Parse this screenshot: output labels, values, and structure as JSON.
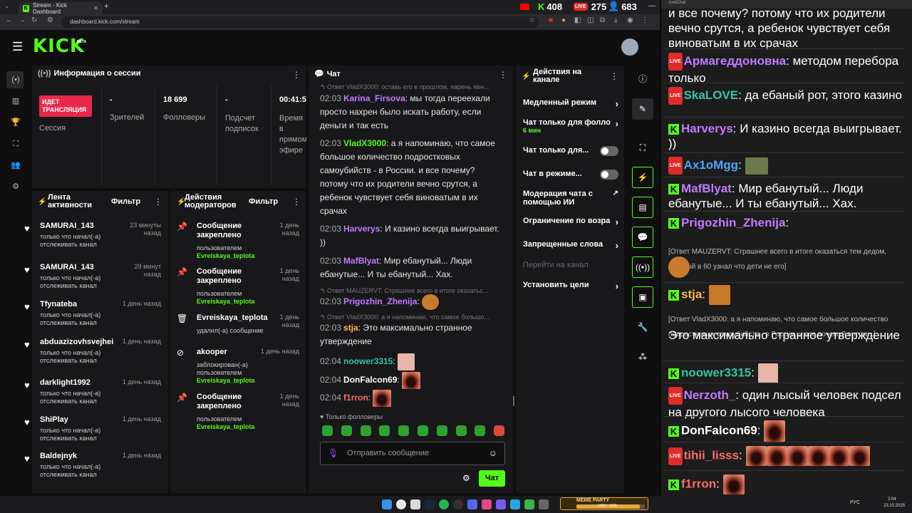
{
  "browser": {
    "tab_title": "Stream - Kick Dashboard",
    "url": "dashboard.kick.com/stream",
    "new_tab": "+",
    "viewers": [
      {
        "platform": "youtube",
        "count": "408"
      },
      {
        "platform": "kick-live",
        "count": "275"
      },
      {
        "platform": "people",
        "count": "683"
      }
    ],
    "window_controls": [
      "—",
      "▢",
      "✕"
    ]
  },
  "header": {
    "logo": "KICK",
    "logo_badge": "BETA"
  },
  "session": {
    "title": "Информация о сессии",
    "live_label_1": "ИДЕТ",
    "live_label_2": "ТРАНСЛЯЦИЯ",
    "session_label": "Сессия",
    "viewers_value": "-",
    "viewers_label": "Зрителей",
    "followers_value": "18 699",
    "followers_label": "Фолловеры",
    "subs_value": "-",
    "subs_label_1": "Подсчет",
    "subs_label_2": "подписок",
    "time_value": "00:41:5",
    "time_label_1": "Время в",
    "time_label_2": "прямом",
    "time_label_3": "эфире"
  },
  "activity": {
    "title_1": "Лента",
    "title_2": "активности",
    "filter": "Фильтр",
    "items": [
      {
        "name": "SAMURAI_143",
        "time": "23 минуты назад",
        "sub_1": "только что начал(-а)",
        "sub_2": "отслеживать канал"
      },
      {
        "name": "SAMURAI_143",
        "time": "29 минут назад",
        "sub_1": "только что начал(-а)",
        "sub_2": "отслеживать канал"
      },
      {
        "name": "Tfynateba",
        "time": "1 день назад",
        "sub_1": "только что начал(-а)",
        "sub_2": "отслеживать канал"
      },
      {
        "name": "abduazizovhsvejhei",
        "time": "1 день назад",
        "sub_1": "только что начал(-а)",
        "sub_2": "отслеживать канал"
      },
      {
        "name": "darklight1992",
        "time": "1 день назад",
        "sub_1": "только что начал(-а)",
        "sub_2": "отслеживать канал"
      },
      {
        "name": "ShiPlay",
        "time": "1 день назад",
        "sub_1": "только что начал(-а)",
        "sub_2": "отслеживать канал"
      },
      {
        "name": "Baldejnyk",
        "time": "1 день назад",
        "sub_1": "только что начал(-а)",
        "sub_2": "отслеживать канал"
      }
    ]
  },
  "mod": {
    "title_1": "Действия",
    "title_2": "модераторов",
    "filter": "Фильтр",
    "items": [
      {
        "line_1": "Сообщение",
        "line_2": "закреплено",
        "sub": "пользователем",
        "user": "Evreiskaya_teplota",
        "time_1": "1 день",
        "time_2": "назад"
      },
      {
        "line_1": "Сообщение",
        "line_2": "закреплено",
        "sub": "пользователем",
        "user": "Evreiskaya_teplota",
        "time_1": "1 день",
        "time_2": "назад"
      },
      {
        "line_1": "Evreiskaya_teplota",
        "line_2": "",
        "sub": "удалил(-а) сообщение",
        "user": "",
        "time_1": "1 день",
        "time_2": "назад"
      },
      {
        "line_1": "akooper",
        "line_2": "",
        "sub": "заблокирован(-а)",
        "sub_2": "пользователем",
        "user": "Evreiskaya_teplota",
        "time_1": "1 день назад",
        "time_2": ""
      },
      {
        "line_1": "Сообщение",
        "line_2": "закреплено",
        "sub": "пользователем",
        "user": "Evreiskaya_teplota",
        "time_1": "1 день",
        "time_2": "назад"
      }
    ]
  },
  "chat": {
    "title": "Чат",
    "top_reply": "↰ Ответ VladX3000: оставь его в прошлом, парень явн...",
    "messages": [
      {
        "time": "02:03",
        "user": "Karina_Firsova",
        "color": "#c07cff",
        "text": "мы тогда переехали просто нахрен было искать работу, если деньги и так есть"
      },
      {
        "time": "02:03",
        "user": "VladX3000",
        "color": "#53fc18",
        "text": "а я напоминаю, что самое большое количество подростковых самоубийств - в России. и все почему? потому что их родители вечно срутся, а ребенок чувствует себя виноватым в их срачах"
      },
      {
        "time": "02:03",
        "user": "Harverys",
        "color": "#c07cff",
        "text": "И казино всегда выигрывает. ))"
      },
      {
        "time": "02:03",
        "user": "MafBlyat",
        "color": "#c07cff",
        "text": "Мир ебанутый... Люди ебанутые... И ты ебанутый... Хах."
      },
      {
        "time": "02:03",
        "user": "Prigozhin_Zhenija",
        "color": "#c07cff",
        "text": ""
      },
      {
        "time": "02:03",
        "user": "stja",
        "color": "#ffb84d",
        "text": "Это максимально странное утверждение"
      },
      {
        "time": "02:04",
        "user": "noower3315",
        "color": "#39c2a8",
        "text": ""
      },
      {
        "time": "02:04",
        "user": "DonFalcon69",
        "color": "#ffffff",
        "text": ""
      },
      {
        "time": "02:04",
        "user": "f1rron",
        "color": "#ff6b6b",
        "text": ""
      }
    ],
    "reply_mauzervt": "↰ Ответ MAUZERVT: Страшнее всего в итоге оказатьс...",
    "reply_vladx": "↰ Ответ VladX3000: а я напоминаю, что самое большо...",
    "followers_only": "♥ Только фолловеры",
    "input_placeholder": "Отправить сообщение",
    "send_label": "Чат"
  },
  "actions": {
    "title_1": "Действия на",
    "title_2": "канале",
    "items": [
      {
        "label": "Медленный режим",
        "kind": "chevron"
      },
      {
        "label": "Чат только для фолло",
        "sub": "6 мин",
        "kind": "chevron"
      },
      {
        "label": "Чат только для...",
        "kind": "toggle"
      },
      {
        "label": "Чат в режиме...",
        "kind": "toggle"
      },
      {
        "label": "Модерация чата с",
        "label_2": "помощью ИИ",
        "kind": "external"
      },
      {
        "label": "Ограничение по возра",
        "kind": "chevron"
      },
      {
        "label": "Запрещенные слова",
        "kind": "chevron"
      },
      {
        "label": "Перейти на канал",
        "kind": "disabled"
      },
      {
        "label": "Установить цели",
        "kind": "chevron"
      }
    ]
  },
  "overlay": {
    "window_title": "AxelChat",
    "lines": [
      {
        "text": "и все почему? потому что их родители вечно срутся, а ребенок чувствует себя виноватым в их срачах"
      },
      {
        "badge": "live",
        "user": "Армагеддоновна",
        "color": "#c07cff",
        "text": "методом перебора только"
      },
      {
        "badge": "live",
        "user": "SkaLOVE",
        "color": "#39c2a8",
        "text": "да ебаный рот, этого казино"
      },
      {
        "badge": "kick",
        "user": "Harverys",
        "color": "#c07cff",
        "text": "И казино всегда выигрывает. ))"
      },
      {
        "badge": "live",
        "user": "Ax1oMgg",
        "color": "#4aa8ff",
        "text": ""
      },
      {
        "badge": "kick",
        "user": "MafBlyat",
        "color": "#c07cff",
        "text": "Мир ебанутый... Люди ебанутые... И ты ебанутый... Хах."
      },
      {
        "badge": "kick",
        "user": "Prigozhin_Zhenija",
        "color": "#c07cff",
        "text": ""
      },
      {
        "reply": "[Ответ MAUZERVT: Страшнее всего в итоге оказаться тем дедом, который в 60 узнал что дети не его]"
      },
      {
        "badge": "kick",
        "user": "stja",
        "color": "#ffb84d",
        "text": ""
      },
      {
        "reply": "[Ответ VladX3000: а я напоминаю, что самое большое количество подростковых самоубийств - в России. и все почему? потом...]"
      },
      {
        "text": "Это максимально странное утверждение"
      },
      {
        "badge": "kick",
        "user": "noower3315",
        "color": "#39c2a8",
        "text": ""
      },
      {
        "badge": "live",
        "user": "Nerzoth_",
        "color": "#c07cff",
        "text": "один лысый человек подсел на другого лысого человека"
      },
      {
        "badge": "kick",
        "user": "DonFalcon69",
        "color": "#ffffff",
        "text": ""
      },
      {
        "badge": "live",
        "user": "tihii_lisss",
        "color": "#ff6b6b",
        "text": ""
      },
      {
        "badge": "kick",
        "user": "f1rron",
        "color": "#ff6b6b",
        "text": ""
      }
    ]
  },
  "taskbar": {
    "time": "2:04",
    "date": "23.10.2025",
    "lang": "РУС",
    "meme_label": "MEME PARTY",
    "meme_progress": "1400 / 1500"
  }
}
